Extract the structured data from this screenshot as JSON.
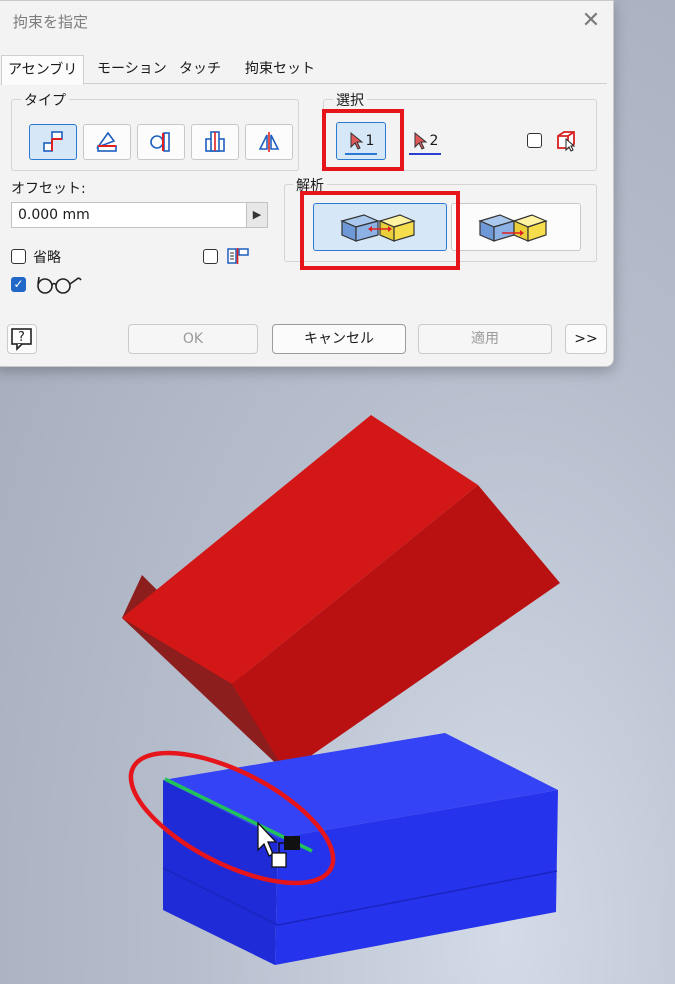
{
  "dialog": {
    "title": "拘束を指定",
    "tabs": [
      {
        "label": "アセンブリ",
        "active": true
      },
      {
        "label": "モーション",
        "active": false
      },
      {
        "label": "タッチ",
        "active": false
      },
      {
        "label": "拘束セット",
        "active": false
      }
    ],
    "type_group": {
      "label": "タイプ",
      "buttons": [
        {
          "icon": "mate-constraint-icon",
          "active": true
        },
        {
          "icon": "angle-constraint-icon",
          "active": false
        },
        {
          "icon": "tangent-constraint-icon",
          "active": false
        },
        {
          "icon": "insert-constraint-icon",
          "active": false
        },
        {
          "icon": "symmetry-constraint-icon",
          "active": false
        }
      ]
    },
    "selection_group": {
      "label": "選択",
      "select1_label": "1",
      "select2_label": "2",
      "pick_part_first_checked": false
    },
    "offset": {
      "label": "オフセット:",
      "value": "0.000 mm"
    },
    "solution_group": {
      "label": "解析",
      "options": [
        {
          "icon": "mate-solution-icon",
          "active": true
        },
        {
          "icon": "flush-solution-icon",
          "active": false
        }
      ]
    },
    "omit": {
      "label": "省略",
      "checked": false
    },
    "predict_offset_checked": false,
    "show_preview_checked": true,
    "buttons": {
      "help_icon": "help-icon",
      "ok": "OK",
      "cancel": "キャンセル",
      "apply": "適用",
      "expand": ">>"
    },
    "colors": {
      "accent": "#2167c8",
      "highlight": "#e5151b"
    }
  },
  "scene": {
    "red_block_color": "#c31212",
    "blue_block_color": "#2a36f3",
    "selected_edge_color": "#22c25a",
    "annotation_color": "#e5151b"
  }
}
